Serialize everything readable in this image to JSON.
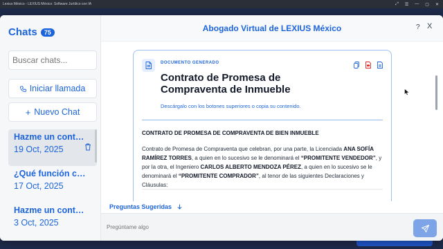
{
  "browser": {
    "title": "Lexius México - LEXIUS México: Software Jurídico con IA",
    "controls": [
      "⤢",
      "☰",
      "—",
      "▢",
      "✕"
    ]
  },
  "sidebar": {
    "title": "Chats",
    "count": "75",
    "search_placeholder": "Buscar chats...",
    "call_label": "Iniciar llamada",
    "new_chat_label": "Nuevo Chat",
    "chats": [
      {
        "title": "Hazme un cont…",
        "date": "19 Oct, 2025",
        "active": true
      },
      {
        "title": "¿Qué función c…",
        "date": "17 Oct, 2025",
        "active": false
      },
      {
        "title": "Hazme un cont…",
        "date": "3 Oct, 2025",
        "active": false
      }
    ]
  },
  "header": {
    "title": "Abogado Virtual de LEXIUS México",
    "help": "?",
    "close": "X"
  },
  "document": {
    "label": "DOCUMENTO GENERADO",
    "title": "Contrato de Promesa de Compraventa de Inmueble",
    "hint": "Descárgalo con los botones superiores o copia su contenido.",
    "heading": "CONTRATO DE PROMESA DE COMPRAVENTA DE BIEN INMUEBLE",
    "body": {
      "p1": "Contrato de Promesa de Compraventa que celebran, por una parte, la Licenciada ",
      "seller": "ANA SOFÍA RAMÍREZ TORRES",
      "p2": ", a quien en lo sucesivo se le denominará el ",
      "seller_role": "“PROMITENTE VENDEDOR”",
      "p3": ", y por la otra, el Ingeniero ",
      "buyer": "CARLOS ALBERTO MENDOZA PÉREZ",
      "p4": ", a quien en lo sucesivo se le denominará el ",
      "buyer_role": "“PROMITENTE COMPRADOR”",
      "p5": ", al tenor de las siguientes Declaraciones y Cláusulas:"
    }
  },
  "suggestions_label": "Preguntas Sugeridas",
  "input": {
    "placeholder": "Pregúntame algo"
  },
  "colors": {
    "accent": "#1c64dc",
    "send": "#7ea4e8",
    "pdf": "#dc2626"
  },
  "icons": {
    "call": "phone-icon",
    "new": "plus-icon",
    "doc": "document-icon",
    "copy": "copy-icon",
    "pdf": "pdf-icon",
    "word": "word-icon",
    "send": "send-icon",
    "suggest": "arrow-down-icon"
  }
}
